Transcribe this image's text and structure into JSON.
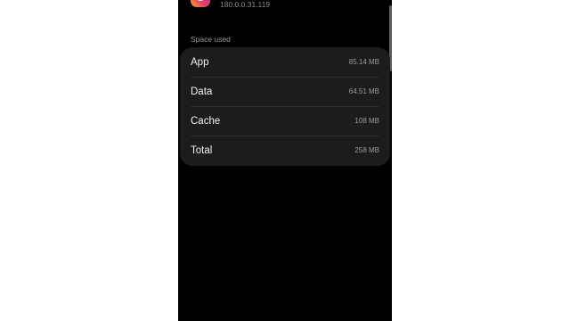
{
  "app_header": {
    "icon": "instagram-icon",
    "version": "180.0.0.31.119"
  },
  "space_used": {
    "section_label": "Space used",
    "rows": [
      {
        "label": "App",
        "value": "85.14 MB"
      },
      {
        "label": "Data",
        "value": "64.51 MB"
      },
      {
        "label": "Cache",
        "value": "108 MB"
      },
      {
        "label": "Total",
        "value": "258 MB"
      }
    ]
  }
}
